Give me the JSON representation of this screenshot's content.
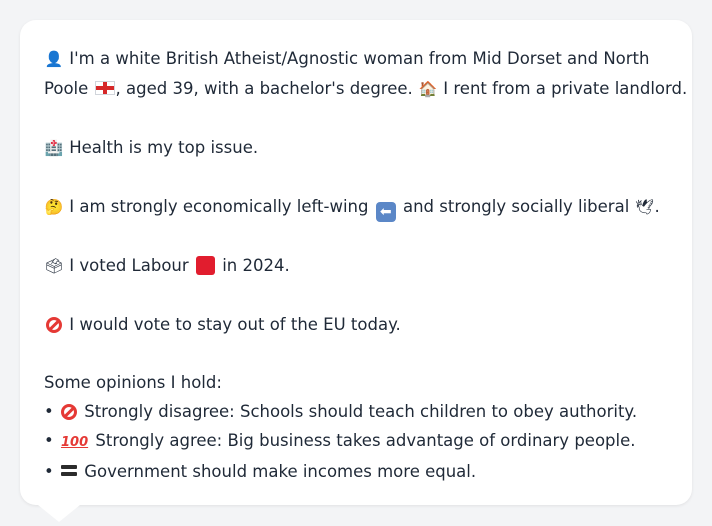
{
  "persona": {
    "intro_part1": "I'm a white British Atheist/Agnostic woman from Mid Dorset and North",
    "intro_part2": "Poole",
    "intro_part3": ", aged 39, with a bachelor's degree.",
    "intro_part4": "I rent from a private landlord.",
    "health": "Health is my top issue.",
    "econ_part1": "I am strongly economically left-wing",
    "econ_part2": "and strongly socially liberal",
    "econ_part3": ".",
    "vote_part1": "I voted Labour",
    "vote_part2": "in 2024.",
    "eu": "I would vote to stay out of the EU today.",
    "opinions_heading": "Some opinions I hold:",
    "opinions": [
      {
        "bullet": "•",
        "icon": "no-entry-icon",
        "text": "Strongly disagree: Schools should teach children to obey authority."
      },
      {
        "bullet": "•",
        "icon": "hundred-points-icon",
        "text": "Strongly agree: Big business takes advantage of ordinary people."
      },
      {
        "bullet": "•",
        "icon": "equals-icon",
        "text": "Government should make incomes more equal."
      }
    ]
  },
  "icons": {
    "person": "👤",
    "house": "🏠",
    "hospital": "🏥",
    "thinking": "🤔",
    "dove": "🕊",
    "ballot": "🗳",
    "hundred": "💯"
  },
  "colors": {
    "card_background": "#ffffff",
    "page_background": "#f3f4f6",
    "text": "#1f2937",
    "labour_red": "#e11d2e",
    "no_entry_red": "#e53935"
  }
}
